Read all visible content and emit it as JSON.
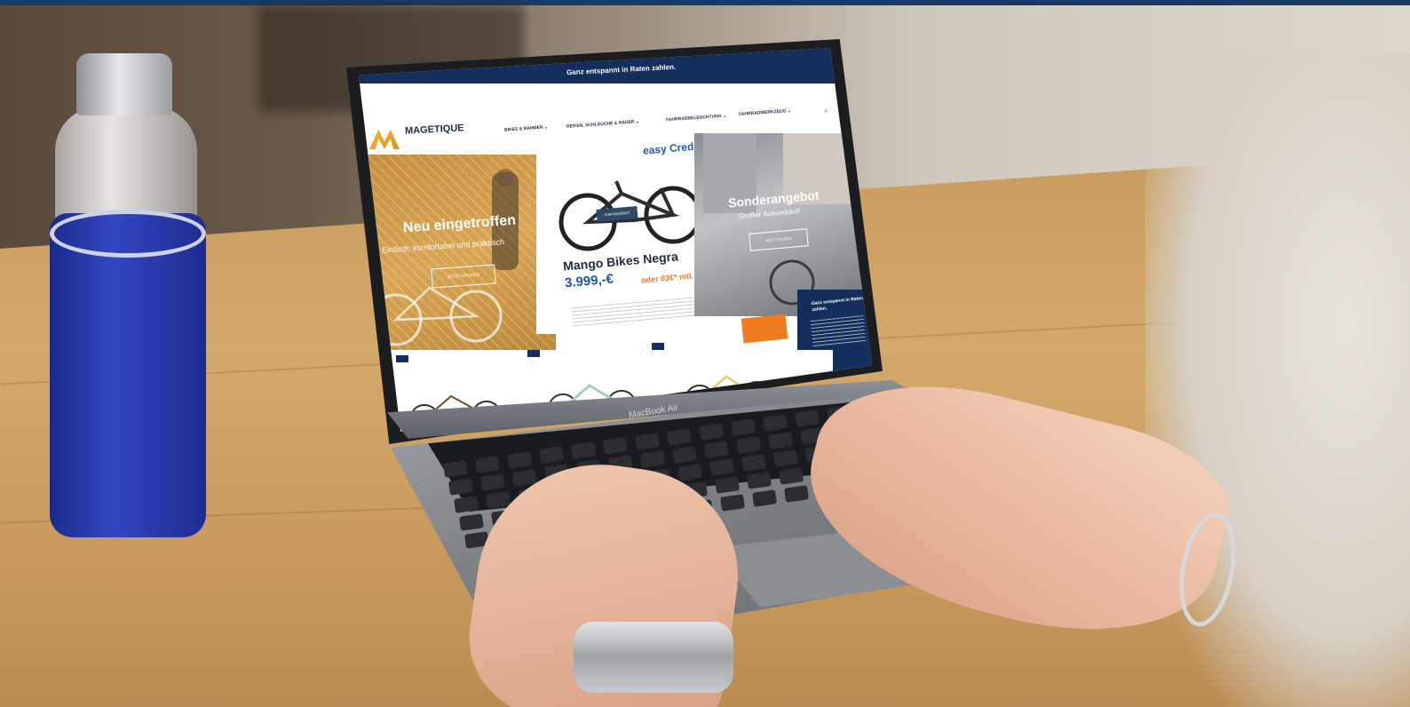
{
  "screen": {
    "topbar_text": "Ganz entspannt in Raten zahlen.",
    "util_links": [
      "",
      "",
      ""
    ],
    "logo": {
      "name": "MAGETIQUE",
      "tagline": ""
    },
    "nav": [
      "BIKES & RAHMEN ⌄",
      "REIFEN, SCHLÄUCHE & RÄDER ⌄",
      "FAHRRADBELEUCHTUNG ⌄",
      "FAHRRADWERKZEUG ⌄"
    ],
    "banner_left": {
      "title": "Neu eingetroffen",
      "subtitle": "Einfach, komfortabel und praktisch",
      "button": "JETZT KAUFEN"
    },
    "banner_mid": {
      "logo": "easy Credit",
      "bike_label": "ZUM ANGEBOT",
      "title": "Mango Bikes Negra",
      "price": "3.999,-€",
      "rate": "oder 83€* mtl."
    },
    "banner_right": {
      "title": "Sonderangebot",
      "subtitle": "Großer Ausverkauf!",
      "button": "JETZT KAUFEN"
    },
    "popup": {
      "title": "Ganz entspannt in Raten zahlen."
    },
    "laptop_label": "MacBook Air"
  },
  "colors": {
    "brand_navy": "#142f5c",
    "brand_orange": "#f07c1f",
    "brand_gold": "#e4a23a"
  }
}
